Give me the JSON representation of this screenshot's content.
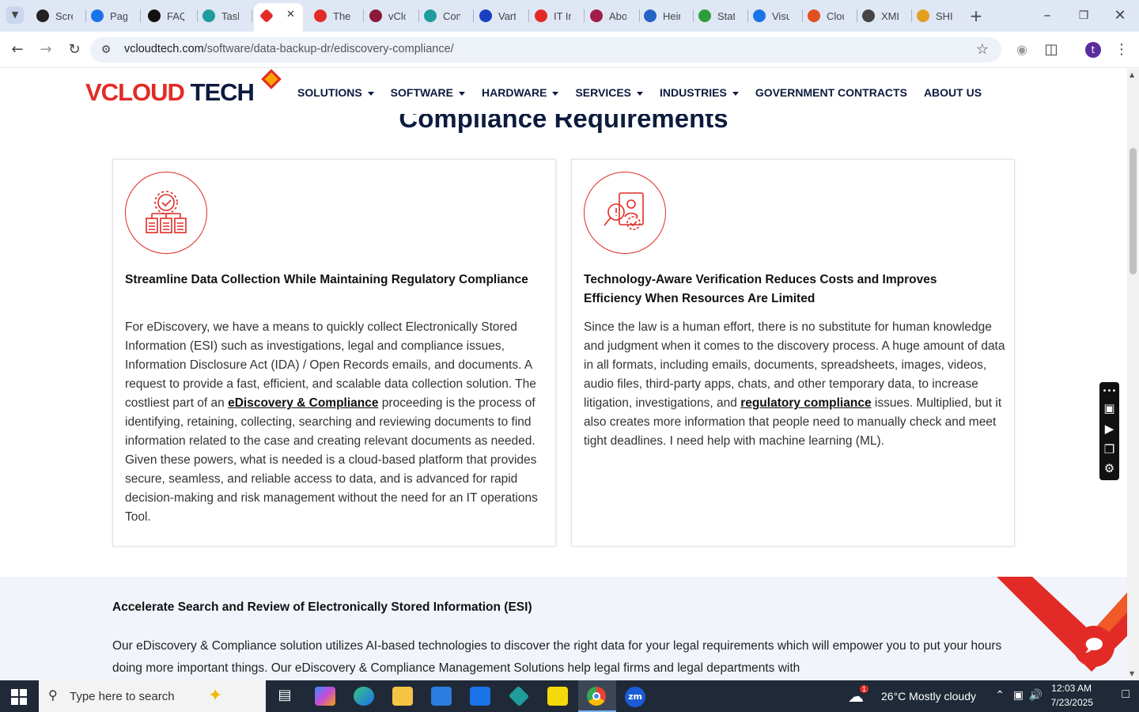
{
  "browser": {
    "tabs": [
      {
        "title": "Scre",
        "color": "#222"
      },
      {
        "title": "Pag",
        "color": "#1a73e8"
      },
      {
        "title": "FAQ",
        "color": "#111"
      },
      {
        "title": "Task",
        "color": "#1f9c9c"
      },
      {
        "title": "",
        "color": "#e22b26",
        "active": true
      },
      {
        "title": "The",
        "color": "#e22b26"
      },
      {
        "title": "vClo",
        "color": "#8b1a3a"
      },
      {
        "title": "Con",
        "color": "#1f9c9c"
      },
      {
        "title": "Vart",
        "color": "#1a3fc4"
      },
      {
        "title": "IT In",
        "color": "#e22b26"
      },
      {
        "title": "Abo",
        "color": "#a11d4a"
      },
      {
        "title": "Hein",
        "color": "#2563c4"
      },
      {
        "title": "Stat",
        "color": "#2d9c3a"
      },
      {
        "title": "Visu",
        "color": "#1a73e8"
      },
      {
        "title": "Clou",
        "color": "#e25020"
      },
      {
        "title": "XML",
        "color": "#444"
      },
      {
        "title": "SHI",
        "color": "#e2a020"
      }
    ],
    "url_domain": "vcloudtech.com",
    "url_path": "/software/data-backup-dr/ediscovery-compliance/",
    "profile_initial": "t"
  },
  "site": {
    "logo_main": "VCLOUD",
    "logo_tail": "TECH",
    "nav": [
      {
        "label": "SOLUTIONS",
        "dropdown": true
      },
      {
        "label": "SOFTWARE",
        "dropdown": true
      },
      {
        "label": "HARDWARE",
        "dropdown": true
      },
      {
        "label": "SERVICES",
        "dropdown": true
      },
      {
        "label": "INDUSTRIES",
        "dropdown": true
      },
      {
        "label": "GOVERNMENT CONTRACTS",
        "dropdown": false
      },
      {
        "label": "ABOUT US",
        "dropdown": false
      }
    ],
    "hero_title": "Compliance Requirements"
  },
  "cards": [
    {
      "title": "Streamline Data Collection While Maintaining Regulatory Compliance",
      "text_before": "For eDiscovery, we have a means to quickly collect Electronically Stored Information (ESI) such as investigations, legal and compliance issues, Information Disclosure Act (IDA) / Open Records emails, and documents. A request to provide a fast, efficient, and scalable data collection solution. The costliest part of an ",
      "link": "eDiscovery & Compliance",
      "text_after": " proceeding is the process of identifying, retaining, collecting, searching and reviewing documents to find information related to the case and creating relevant documents as needed. Given these powers, what is needed is a cloud-based platform that provides secure, seamless, and reliable access to data, and is advanced for rapid decision-making and risk management without the need for an IT operations Tool."
    },
    {
      "title": "Technology-Aware Verification Reduces Costs and Improves Efficiency When Resources Are Limited",
      "text_before": "Since the law is a human effort, there is no substitute for human knowledge and judgment when it comes to the discovery process. A huge amount of data in all formats, including emails, documents, spreadsheets, images, videos, audio files, third-party apps, chats, and other temporary data, to increase litigation, investigations, and ",
      "link": "regulatory compliance",
      "text_after": " issues. Multiplied, but it also creates more information that people need to manually check and meet tight deadlines. I need help with machine learning (ML)."
    }
  ],
  "esi": {
    "heading": "Accelerate Search and Review of Electronically Stored Information (ESI)",
    "text": "Our eDiscovery & Compliance solution utilizes AI-based technologies to discover the right data for your legal requirements which will empower you to put your hours doing more important things. Our eDiscovery & Compliance Management Solutions help legal firms and legal departments with"
  },
  "taskbar": {
    "search_placeholder": "Type here to search",
    "weather": "26°C  Mostly cloudy",
    "weather_badge": "1",
    "time": "12:03 AM",
    "date": "7/23/2025"
  },
  "colors": {
    "brand_red": "#e22b26",
    "navy": "#0d1b3e"
  }
}
